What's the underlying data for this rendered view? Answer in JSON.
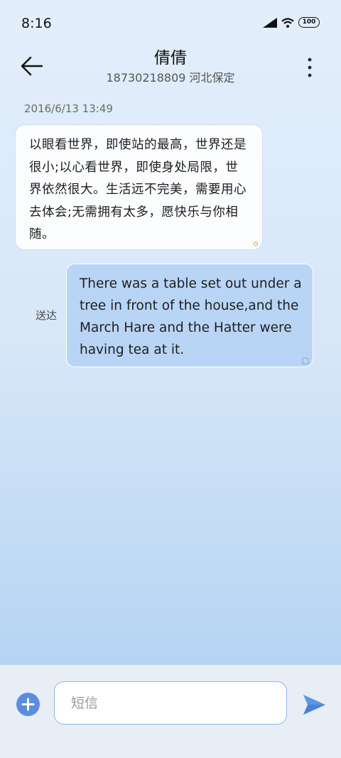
{
  "status_bar": {
    "time": "8:16",
    "battery": "100",
    "icons": [
      "signal-icon",
      "wifi-icon",
      "battery-icon"
    ]
  },
  "header": {
    "contact_name": "倩倩",
    "contact_info": "18730218809 河北保定",
    "back_icon": "back-arrow-icon",
    "menu_icon": "more-vertical-icon"
  },
  "messages": {
    "timestamp": "2016/6/13 13:49",
    "incoming": {
      "text": "以眼看世界，即使站的最高，世界还是很小;以心看世界，即使身处局限，世界依然很大。生活远不完美，需要用心去体会;无需拥有太多，愿快乐与你相随。"
    },
    "outgoing": {
      "status": "送达",
      "text": "There was a table set out under a tree in front of the house,and the March Hare and the Hatter were having tea at it."
    }
  },
  "composer": {
    "placeholder": "短信",
    "value": "",
    "add_icon": "add-icon",
    "send_icon": "send-icon"
  },
  "colors": {
    "accent": "#5a8de0",
    "outgoing_bubble": "#b9d5f6",
    "incoming_bubble": "#fbfdff",
    "bottom_bar": "#e8eef5"
  }
}
